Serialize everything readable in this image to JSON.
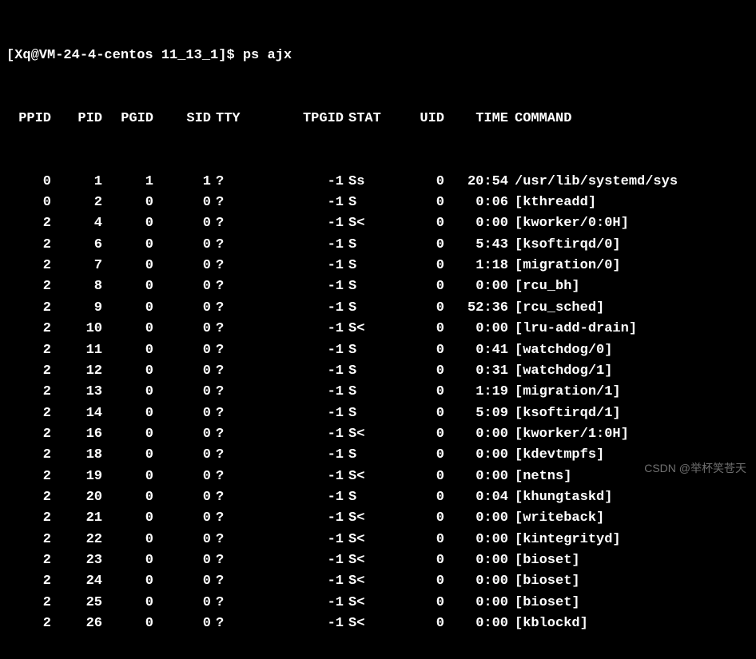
{
  "prompt": "[Xq@VM-24-4-centos 11_13_1]$ ",
  "command": "ps ajx",
  "headers": {
    "ppid": "PPID",
    "pid": "PID",
    "pgid": "PGID",
    "sid": "SID",
    "tty": "TTY",
    "tpgid": "TPGID",
    "stat": "STAT",
    "uid": "UID",
    "time": "TIME",
    "cmd": "COMMAND"
  },
  "rows": [
    {
      "ppid": "0",
      "pid": "1",
      "pgid": "1",
      "sid": "1",
      "tty": "?",
      "tpgid": "-1",
      "stat": "Ss",
      "uid": "0",
      "time": "20:54",
      "cmd": "/usr/lib/systemd/sys"
    },
    {
      "ppid": "0",
      "pid": "2",
      "pgid": "0",
      "sid": "0",
      "tty": "?",
      "tpgid": "-1",
      "stat": "S",
      "uid": "0",
      "time": "0:06",
      "cmd": "[kthreadd]"
    },
    {
      "ppid": "2",
      "pid": "4",
      "pgid": "0",
      "sid": "0",
      "tty": "?",
      "tpgid": "-1",
      "stat": "S<",
      "uid": "0",
      "time": "0:00",
      "cmd": "[kworker/0:0H]"
    },
    {
      "ppid": "2",
      "pid": "6",
      "pgid": "0",
      "sid": "0",
      "tty": "?",
      "tpgid": "-1",
      "stat": "S",
      "uid": "0",
      "time": "5:43",
      "cmd": "[ksoftirqd/0]"
    },
    {
      "ppid": "2",
      "pid": "7",
      "pgid": "0",
      "sid": "0",
      "tty": "?",
      "tpgid": "-1",
      "stat": "S",
      "uid": "0",
      "time": "1:18",
      "cmd": "[migration/0]"
    },
    {
      "ppid": "2",
      "pid": "8",
      "pgid": "0",
      "sid": "0",
      "tty": "?",
      "tpgid": "-1",
      "stat": "S",
      "uid": "0",
      "time": "0:00",
      "cmd": "[rcu_bh]"
    },
    {
      "ppid": "2",
      "pid": "9",
      "pgid": "0",
      "sid": "0",
      "tty": "?",
      "tpgid": "-1",
      "stat": "S",
      "uid": "0",
      "time": "52:36",
      "cmd": "[rcu_sched]"
    },
    {
      "ppid": "2",
      "pid": "10",
      "pgid": "0",
      "sid": "0",
      "tty": "?",
      "tpgid": "-1",
      "stat": "S<",
      "uid": "0",
      "time": "0:00",
      "cmd": "[lru-add-drain]"
    },
    {
      "ppid": "2",
      "pid": "11",
      "pgid": "0",
      "sid": "0",
      "tty": "?",
      "tpgid": "-1",
      "stat": "S",
      "uid": "0",
      "time": "0:41",
      "cmd": "[watchdog/0]"
    },
    {
      "ppid": "2",
      "pid": "12",
      "pgid": "0",
      "sid": "0",
      "tty": "?",
      "tpgid": "-1",
      "stat": "S",
      "uid": "0",
      "time": "0:31",
      "cmd": "[watchdog/1]"
    },
    {
      "ppid": "2",
      "pid": "13",
      "pgid": "0",
      "sid": "0",
      "tty": "?",
      "tpgid": "-1",
      "stat": "S",
      "uid": "0",
      "time": "1:19",
      "cmd": "[migration/1]"
    },
    {
      "ppid": "2",
      "pid": "14",
      "pgid": "0",
      "sid": "0",
      "tty": "?",
      "tpgid": "-1",
      "stat": "S",
      "uid": "0",
      "time": "5:09",
      "cmd": "[ksoftirqd/1]"
    },
    {
      "ppid": "2",
      "pid": "16",
      "pgid": "0",
      "sid": "0",
      "tty": "?",
      "tpgid": "-1",
      "stat": "S<",
      "uid": "0",
      "time": "0:00",
      "cmd": "[kworker/1:0H]"
    },
    {
      "ppid": "2",
      "pid": "18",
      "pgid": "0",
      "sid": "0",
      "tty": "?",
      "tpgid": "-1",
      "stat": "S",
      "uid": "0",
      "time": "0:00",
      "cmd": "[kdevtmpfs]"
    },
    {
      "ppid": "2",
      "pid": "19",
      "pgid": "0",
      "sid": "0",
      "tty": "?",
      "tpgid": "-1",
      "stat": "S<",
      "uid": "0",
      "time": "0:00",
      "cmd": "[netns]"
    },
    {
      "ppid": "2",
      "pid": "20",
      "pgid": "0",
      "sid": "0",
      "tty": "?",
      "tpgid": "-1",
      "stat": "S",
      "uid": "0",
      "time": "0:04",
      "cmd": "[khungtaskd]"
    },
    {
      "ppid": "2",
      "pid": "21",
      "pgid": "0",
      "sid": "0",
      "tty": "?",
      "tpgid": "-1",
      "stat": "S<",
      "uid": "0",
      "time": "0:00",
      "cmd": "[writeback]"
    },
    {
      "ppid": "2",
      "pid": "22",
      "pgid": "0",
      "sid": "0",
      "tty": "?",
      "tpgid": "-1",
      "stat": "S<",
      "uid": "0",
      "time": "0:00",
      "cmd": "[kintegrityd]"
    },
    {
      "ppid": "2",
      "pid": "23",
      "pgid": "0",
      "sid": "0",
      "tty": "?",
      "tpgid": "-1",
      "stat": "S<",
      "uid": "0",
      "time": "0:00",
      "cmd": "[bioset]"
    },
    {
      "ppid": "2",
      "pid": "24",
      "pgid": "0",
      "sid": "0",
      "tty": "?",
      "tpgid": "-1",
      "stat": "S<",
      "uid": "0",
      "time": "0:00",
      "cmd": "[bioset]"
    },
    {
      "ppid": "2",
      "pid": "25",
      "pgid": "0",
      "sid": "0",
      "tty": "?",
      "tpgid": "-1",
      "stat": "S<",
      "uid": "0",
      "time": "0:00",
      "cmd": "[bioset]"
    },
    {
      "ppid": "2",
      "pid": "26",
      "pgid": "0",
      "sid": "0",
      "tty": "?",
      "tpgid": "-1",
      "stat": "S<",
      "uid": "0",
      "time": "0:00",
      "cmd": "[kblockd]"
    }
  ],
  "watermark": "CSDN @举杯笑苍天"
}
